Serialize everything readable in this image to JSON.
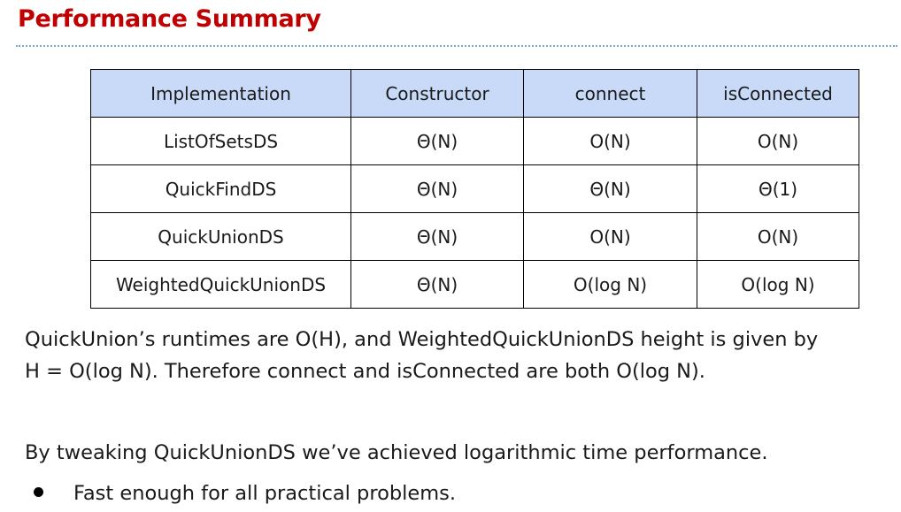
{
  "slide": {
    "title": "Performance Summary"
  },
  "table": {
    "headers": [
      "Implementation",
      "Constructor",
      "connect",
      "isConnected"
    ],
    "rows": [
      [
        "ListOfSetsDS",
        "Θ(N)",
        "O(N)",
        "O(N)"
      ],
      [
        "QuickFindDS",
        "Θ(N)",
        "Θ(N)",
        "Θ(1)"
      ],
      [
        "QuickUnionDS",
        "Θ(N)",
        "O(N)",
        "O(N)"
      ],
      [
        "WeightedQuickUnionDS",
        "Θ(N)",
        "O(log N)",
        "O(log N)"
      ]
    ],
    "header_color": "#c9daf8"
  },
  "body": {
    "paragraph1_line1": "QuickUnion’s runtimes are O(H), and WeightedQuickUnionDS height is given by",
    "paragraph1_line2": "H = O(log N). Therefore connect and isConnected are both O(log N).",
    "paragraph2": "By tweaking QuickUnionDS we’ve achieved logarithmic time performance.",
    "bullets": [
      "Fast enough for all practical problems."
    ]
  },
  "colors": {
    "title": "#c00000",
    "rule": "#6fa8dc"
  }
}
